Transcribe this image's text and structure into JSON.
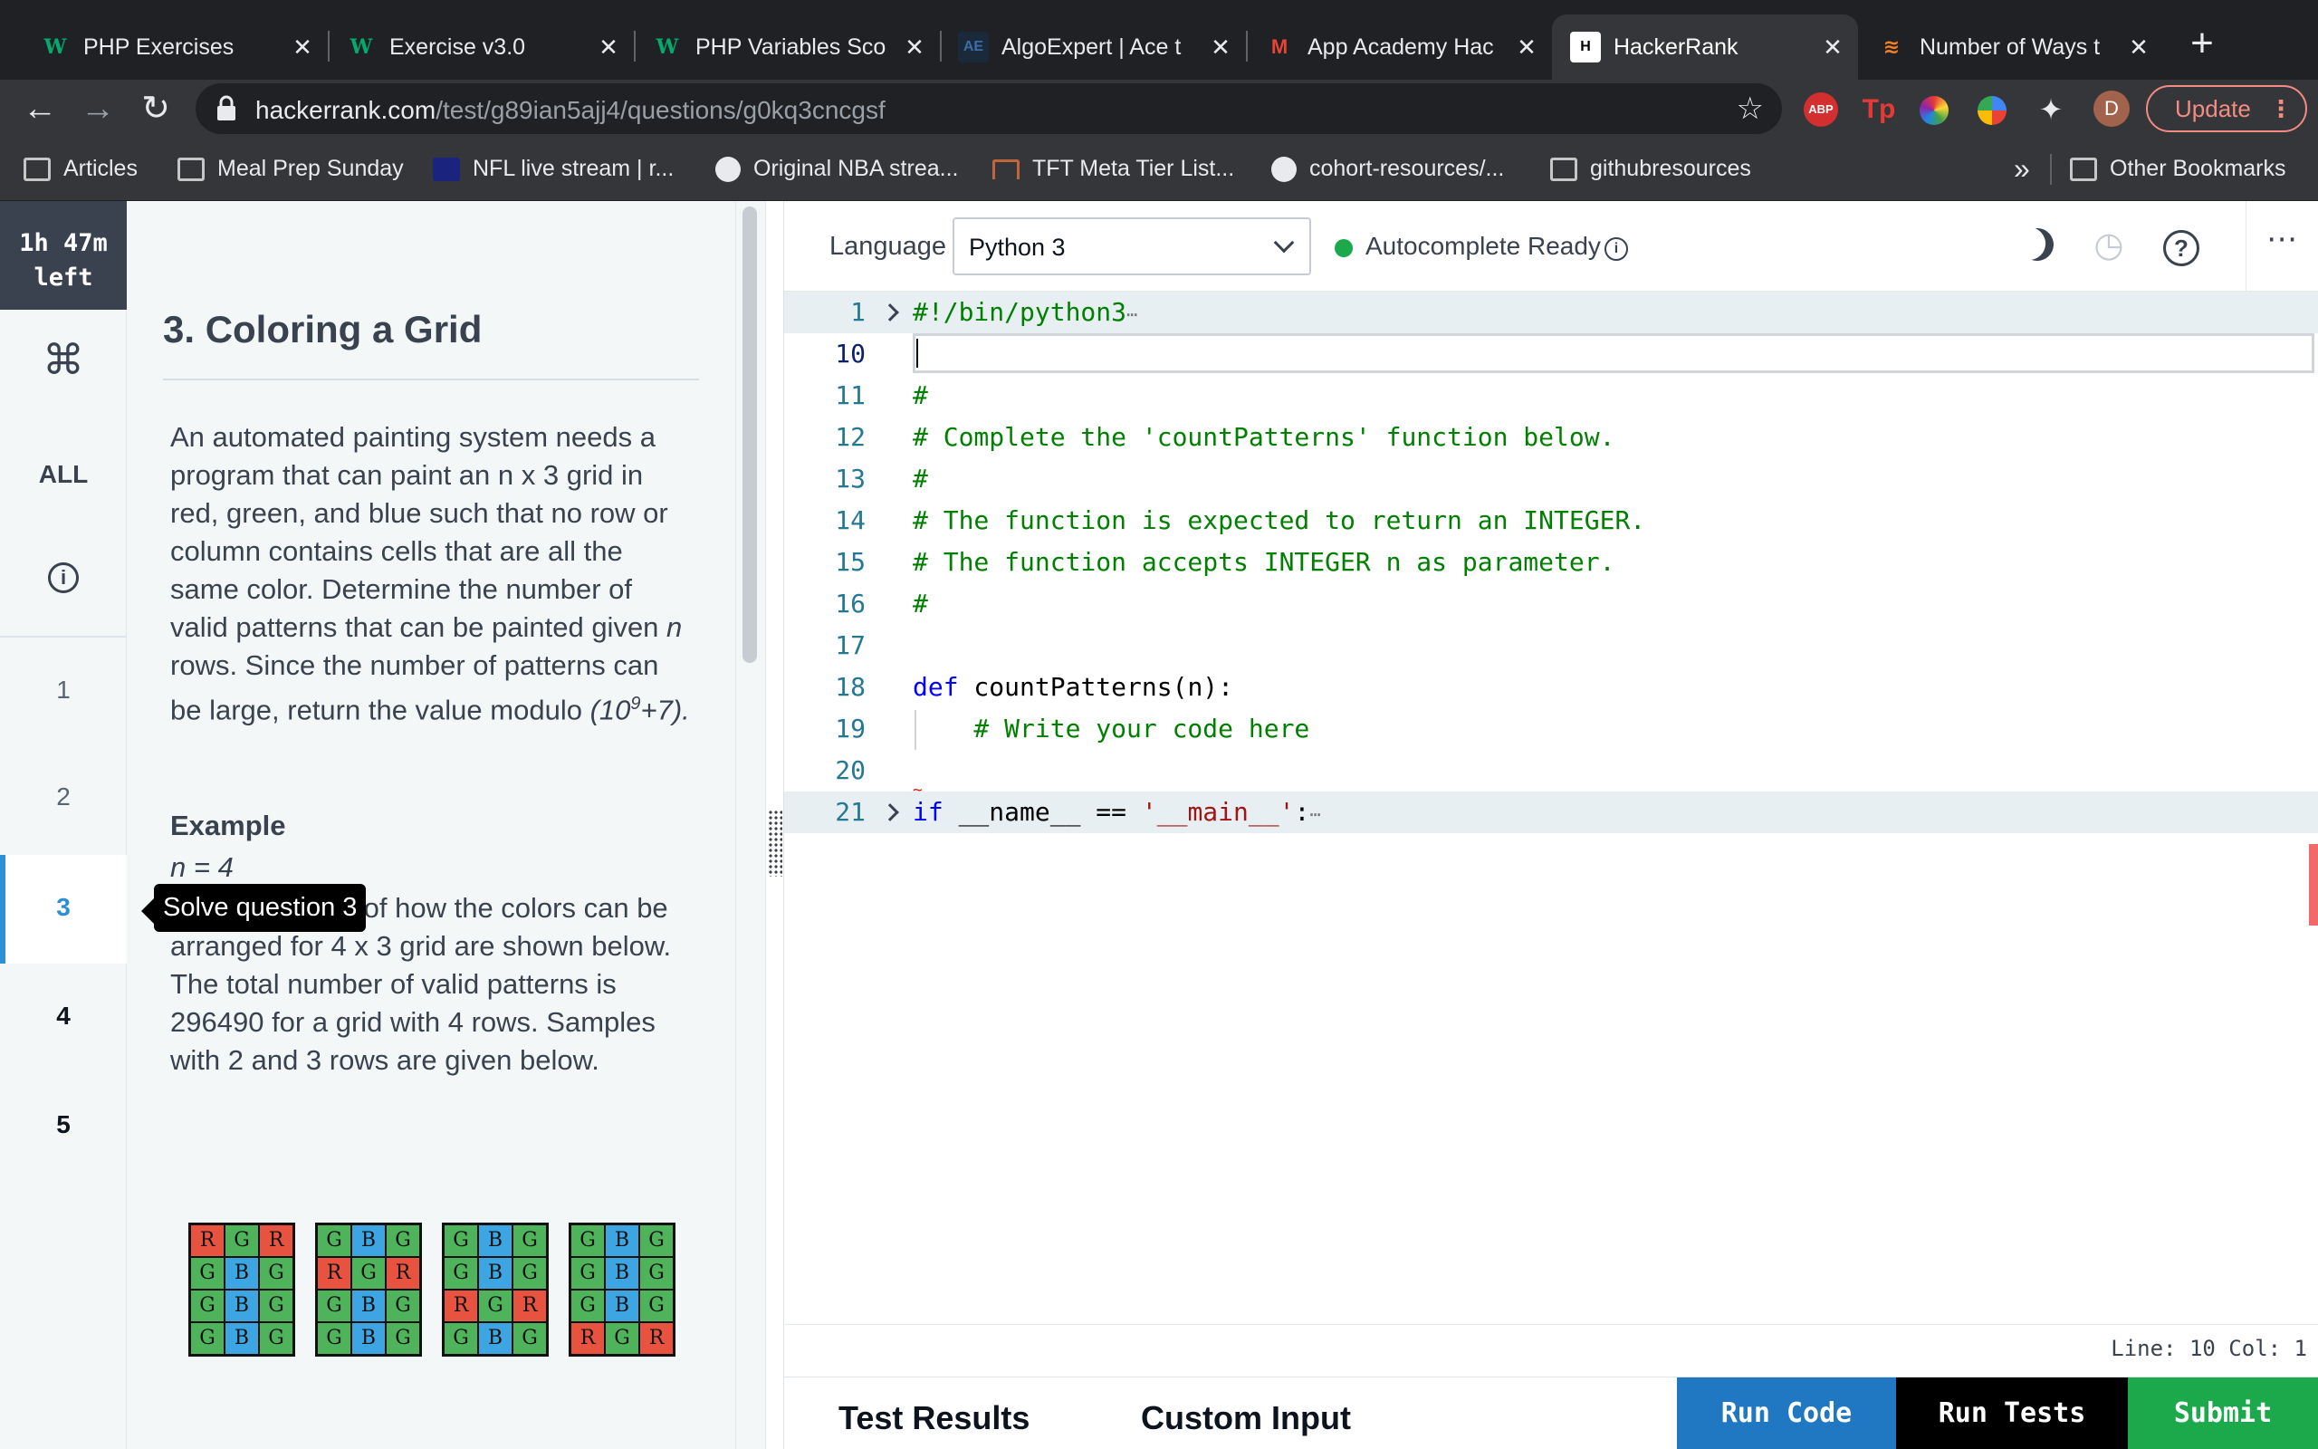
{
  "browser": {
    "tabs": [
      {
        "title": "PHP Exercises",
        "favicon": "w3schools-icon",
        "active": false
      },
      {
        "title": "Exercise v3.0",
        "favicon": "w3schools-icon",
        "active": false
      },
      {
        "title": "PHP Variables Sco",
        "favicon": "w3schools-icon",
        "active": false
      },
      {
        "title": "AlgoExpert | Ace t",
        "favicon": "algoexpert-icon",
        "active": false
      },
      {
        "title": "App Academy Hac",
        "favicon": "gmail-icon",
        "active": false
      },
      {
        "title": "HackerRank",
        "favicon": "hackerrank-icon",
        "active": true
      },
      {
        "title": "Number of Ways t",
        "favicon": "stackoverflow-icon",
        "active": false
      }
    ],
    "new_tab": "+",
    "url_domain": "hackerrank.com",
    "url_path": "/test/g89ian5ajj4/questions/g0kq3cncgsf",
    "profile_initial": "D",
    "update_label": "Update",
    "extensions": {
      "abp": "ABP",
      "tp": "Tp"
    },
    "bookmarks": [
      {
        "label": "Articles",
        "icon": "folder-icon"
      },
      {
        "label": "Meal Prep Sunday",
        "icon": "folder-icon"
      },
      {
        "label": "NFL live stream | r...",
        "icon": "nfl-icon"
      },
      {
        "label": "Original NBA strea...",
        "icon": "globe-icon"
      },
      {
        "label": "TFT Meta Tier List...",
        "icon": "tft-icon"
      },
      {
        "label": "cohort-resources/...",
        "icon": "github-icon"
      },
      {
        "label": "githubresources",
        "icon": "folder-icon"
      }
    ],
    "bookmarks_more": "»",
    "other_bookmarks": "Other Bookmarks"
  },
  "sidebar": {
    "timer_line1": "1h 47m",
    "timer_line2": "left",
    "cmd_glyph": "⌘",
    "all_label": "ALL",
    "info_glyph": "i",
    "questions": [
      "1",
      "2",
      "3",
      "4",
      "5"
    ],
    "selected_question": "3",
    "tooltip": "Solve question 3"
  },
  "problem": {
    "title": "3. Coloring a Grid",
    "description_1": "An automated painting system needs a program that can paint an n x 3 grid in red, green, and blue such that no row or column contains cells that are all the same color. Determine the number of valid patterns that can be painted given ",
    "description_n": "n",
    "description_2": " rows. Since the number of patterns can be large, return the value modulo ",
    "description_mod": "(10",
    "description_exp": "9",
    "description_mod_end": "+7).",
    "example_heading": "Example",
    "example_n": "n = 4",
    "example_1": "Four examples of how the colors can be arranged for ",
    "example_dim": "4 x 3",
    "example_2": " grid are shown below. The total number of valid patterns is ",
    "example_total": "296490",
    "example_3": " for a grid with 4 rows. Samples with 2 and 3 rows are given below.",
    "grids": [
      [
        [
          "R",
          "G",
          "R"
        ],
        [
          "G",
          "B",
          "G"
        ],
        [
          "G",
          "B",
          "G"
        ],
        [
          "G",
          "B",
          "G"
        ]
      ],
      [
        [
          "G",
          "B",
          "G"
        ],
        [
          "R",
          "G",
          "R"
        ],
        [
          "G",
          "B",
          "G"
        ],
        [
          "G",
          "B",
          "G"
        ]
      ],
      [
        [
          "G",
          "B",
          "G"
        ],
        [
          "G",
          "B",
          "G"
        ],
        [
          "R",
          "G",
          "R"
        ],
        [
          "G",
          "B",
          "G"
        ]
      ],
      [
        [
          "G",
          "B",
          "G"
        ],
        [
          "G",
          "B",
          "G"
        ],
        [
          "G",
          "B",
          "G"
        ],
        [
          "R",
          "G",
          "R"
        ]
      ]
    ]
  },
  "editor": {
    "language_label": "Language",
    "language_value": "Python 3",
    "autocomplete_label": "Autocomplete Ready",
    "status": "Line: 10 Col: 1",
    "line_numbers": [
      "1",
      "10",
      "11",
      "12",
      "13",
      "14",
      "15",
      "16",
      "17",
      "18",
      "19",
      "20",
      "21"
    ],
    "lines": {
      "l1": "#!/bin/python3",
      "l11": "#",
      "l12": "# Complete the 'countPatterns' function below.",
      "l13": "#",
      "l14": "# The function is expected to return an INTEGER.",
      "l15": "# The function accepts INTEGER n as parameter.",
      "l16": "#",
      "l18_kw": "def",
      "l18_rest": " countPatterns(n):",
      "l19": "    # Write your code here",
      "l21_kw": "if",
      "l21_mid": " __name__ == ",
      "l21_str": "'__main__'",
      "l21_end": ":",
      "ellipsis": "⋯"
    }
  },
  "bottom": {
    "test_results": "Test Results",
    "custom_input": "Custom Input",
    "run_code": "Run Code",
    "run_tests": "Run Tests",
    "submit": "Submit"
  }
}
